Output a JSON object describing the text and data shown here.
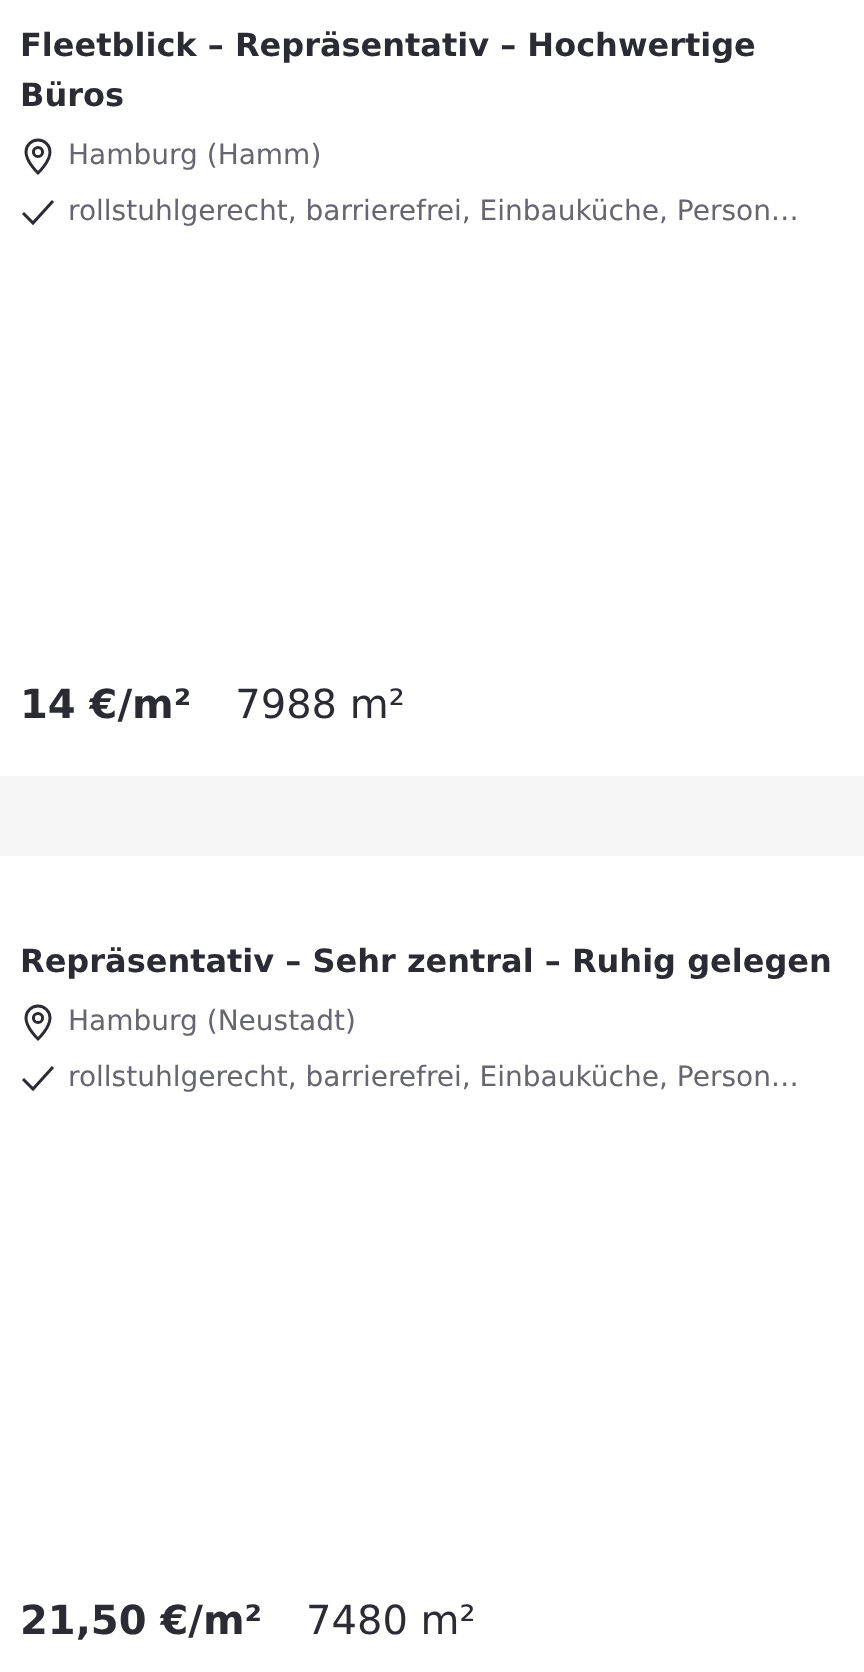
{
  "listings": [
    {
      "title": "Fleetblick – Repräsentativ – Hochwertige Büros",
      "location": "Hamburg (Hamm)",
      "features": "rollstuhlgerecht, barrierefrei, Einbauküche, Person…",
      "price": "14 €/m²",
      "area": "7988 m²"
    },
    {
      "title": "Repräsentativ – Sehr zentral – Ruhig gelegen",
      "location": "Hamburg (Neustadt)",
      "features": "rollstuhlgerecht, barrierefrei, Einbauküche, Person…",
      "price": "21,50 €/m²",
      "area": "7480 m²"
    }
  ]
}
